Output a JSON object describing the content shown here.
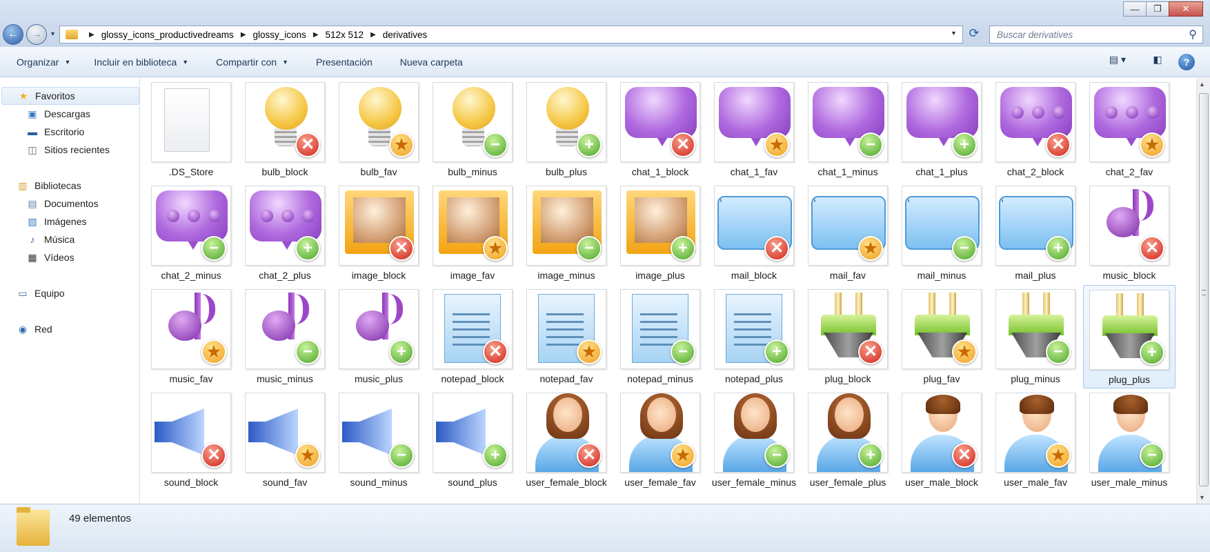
{
  "window": {
    "minimize": "—",
    "maximize": "❐",
    "close": "✕"
  },
  "breadcrumb": [
    "glossy_icons_productivedreams",
    "glossy_icons",
    "512x 512",
    "derivatives"
  ],
  "search": {
    "placeholder": "Buscar derivatives"
  },
  "toolbar": {
    "organizar": "Organizar",
    "incluir": "Incluir en biblioteca",
    "compartir": "Compartir con",
    "presentacion": "Presentación",
    "nueva_carpeta": "Nueva carpeta"
  },
  "sidebar": {
    "favoritos": "Favoritos",
    "descargas": "Descargas",
    "escritorio": "Escritorio",
    "sitios": "Sitios recientes",
    "bibliotecas": "Bibliotecas",
    "documentos": "Documentos",
    "imagenes": "Imágenes",
    "musica": "Música",
    "videos": "Vídeos",
    "equipo": "Equipo",
    "red": "Red"
  },
  "status": {
    "count": "49 elementos"
  },
  "files": [
    {
      "name": ".DS_Store",
      "icon": "file",
      "badge": ""
    },
    {
      "name": "bulb_block",
      "icon": "bulb",
      "badge": "block"
    },
    {
      "name": "bulb_fav",
      "icon": "bulb",
      "badge": "fav"
    },
    {
      "name": "bulb_minus",
      "icon": "bulb",
      "badge": "minus"
    },
    {
      "name": "bulb_plus",
      "icon": "bulb",
      "badge": "plus"
    },
    {
      "name": "chat_1_block",
      "icon": "chat1",
      "badge": "block"
    },
    {
      "name": "chat_1_fav",
      "icon": "chat1",
      "badge": "fav"
    },
    {
      "name": "chat_1_minus",
      "icon": "chat1",
      "badge": "minus"
    },
    {
      "name": "chat_1_plus",
      "icon": "chat1",
      "badge": "plus"
    },
    {
      "name": "chat_2_block",
      "icon": "chat2",
      "badge": "block"
    },
    {
      "name": "chat_2_fav",
      "icon": "chat2",
      "badge": "fav"
    },
    {
      "name": "chat_2_minus",
      "icon": "chat2",
      "badge": "minus"
    },
    {
      "name": "chat_2_plus",
      "icon": "chat2",
      "badge": "plus"
    },
    {
      "name": "image_block",
      "icon": "image",
      "badge": "block"
    },
    {
      "name": "image_fav",
      "icon": "image",
      "badge": "fav"
    },
    {
      "name": "image_minus",
      "icon": "image",
      "badge": "minus"
    },
    {
      "name": "image_plus",
      "icon": "image",
      "badge": "plus"
    },
    {
      "name": "mail_block",
      "icon": "mail",
      "badge": "block"
    },
    {
      "name": "mail_fav",
      "icon": "mail",
      "badge": "fav"
    },
    {
      "name": "mail_minus",
      "icon": "mail",
      "badge": "minus"
    },
    {
      "name": "mail_plus",
      "icon": "mail",
      "badge": "plus"
    },
    {
      "name": "music_block",
      "icon": "music",
      "badge": "block"
    },
    {
      "name": "music_fav",
      "icon": "music",
      "badge": "fav"
    },
    {
      "name": "music_minus",
      "icon": "music",
      "badge": "minus"
    },
    {
      "name": "music_plus",
      "icon": "music",
      "badge": "plus"
    },
    {
      "name": "notepad_block",
      "icon": "notepad",
      "badge": "block"
    },
    {
      "name": "notepad_fav",
      "icon": "notepad",
      "badge": "fav"
    },
    {
      "name": "notepad_minus",
      "icon": "notepad",
      "badge": "minus"
    },
    {
      "name": "notepad_plus",
      "icon": "notepad",
      "badge": "plus"
    },
    {
      "name": "plug_block",
      "icon": "plug",
      "badge": "block"
    },
    {
      "name": "plug_fav",
      "icon": "plug",
      "badge": "fav"
    },
    {
      "name": "plug_minus",
      "icon": "plug",
      "badge": "minus"
    },
    {
      "name": "plug_plus",
      "icon": "plug",
      "badge": "plus",
      "selected": true
    },
    {
      "name": "sound_block",
      "icon": "sound",
      "badge": "block"
    },
    {
      "name": "sound_fav",
      "icon": "sound",
      "badge": "fav"
    },
    {
      "name": "sound_minus",
      "icon": "sound",
      "badge": "minus"
    },
    {
      "name": "sound_plus",
      "icon": "sound",
      "badge": "plus"
    },
    {
      "name": "user_female_block",
      "icon": "female",
      "badge": "block"
    },
    {
      "name": "user_female_fav",
      "icon": "female",
      "badge": "fav"
    },
    {
      "name": "user_female_minus",
      "icon": "female",
      "badge": "minus"
    },
    {
      "name": "user_female_plus",
      "icon": "female",
      "badge": "plus"
    },
    {
      "name": "user_male_block",
      "icon": "male",
      "badge": "block"
    },
    {
      "name": "user_male_fav",
      "icon": "male",
      "badge": "fav"
    },
    {
      "name": "user_male_minus",
      "icon": "male",
      "badge": "minus"
    }
  ]
}
